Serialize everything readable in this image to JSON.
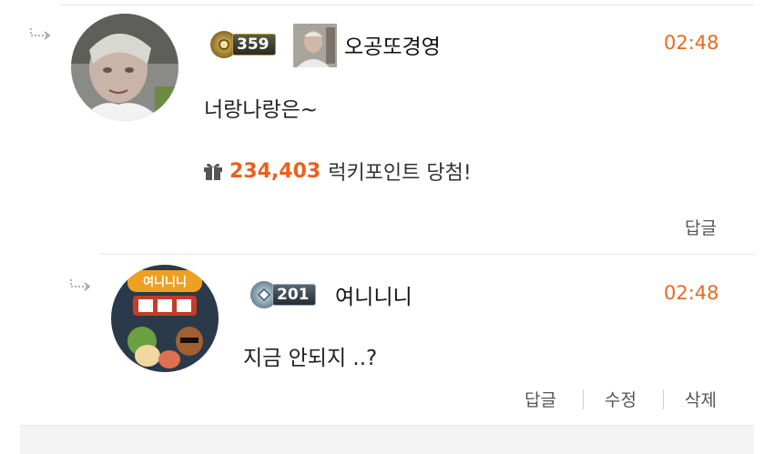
{
  "comments": [
    {
      "level": "359",
      "author": "오공또경영",
      "time": "02:48",
      "text": "너랑나랑은~",
      "lucky_points": "234,403",
      "lucky_label": "럭키포인트 당첨!",
      "actions": {
        "reply": "답글"
      }
    },
    {
      "level": "201",
      "author": "여니니니",
      "time": "02:48",
      "text": "지금 안되지 ..?",
      "avatar_text": "여니니니",
      "actions": {
        "reply": "답글",
        "edit": "수정",
        "delete": "삭제"
      }
    }
  ],
  "colors": {
    "accent": "#e86a21",
    "gold_badge": "#3a3a2a",
    "silver_badge": "#4a5560"
  }
}
